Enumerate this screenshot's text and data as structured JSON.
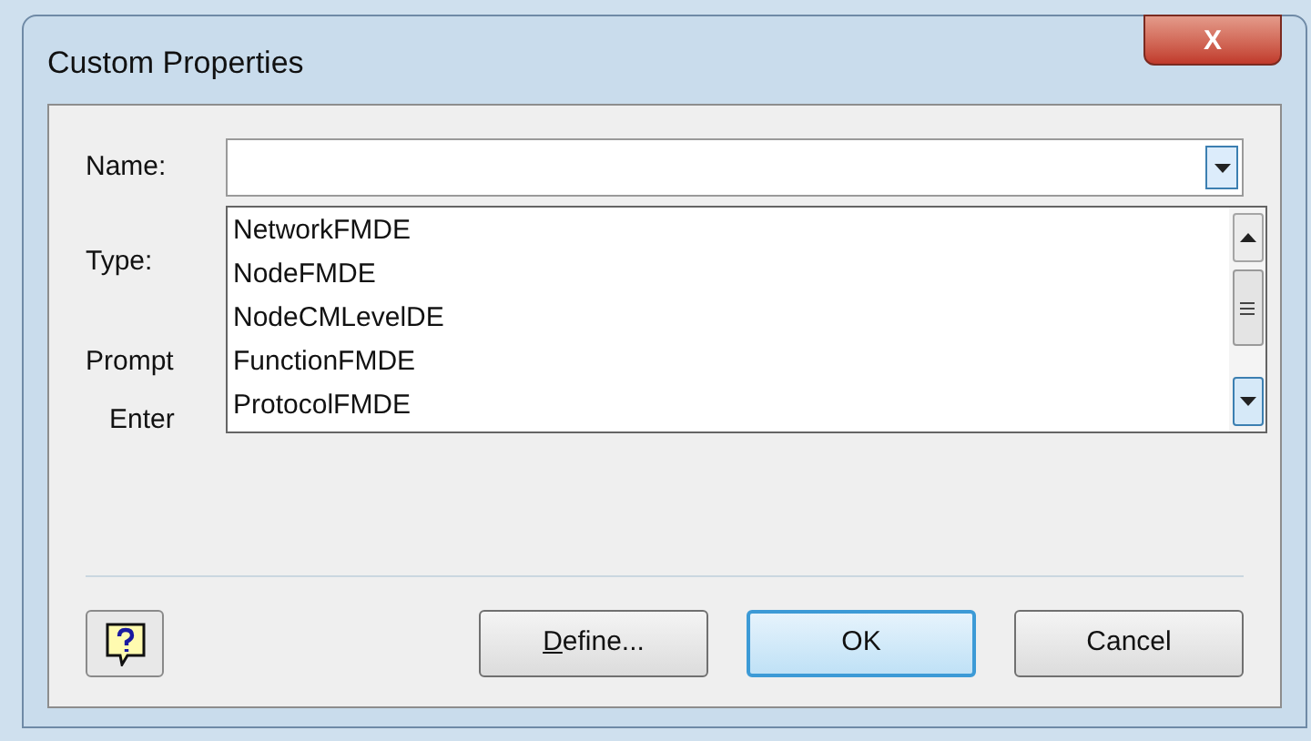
{
  "window": {
    "title": "Custom Properties",
    "close": "X"
  },
  "fields": [
    {
      "label": "Name:"
    },
    {
      "label": "Type:"
    },
    {
      "label": "Prompt"
    },
    {
      "label": "Enter"
    }
  ],
  "dropdown": {
    "items": [
      {
        "label": "NetworkFMDE",
        "selected": false
      },
      {
        "label": "NodeFMDE",
        "selected": false
      },
      {
        "label": "NodeCMLevelDE",
        "selected": false
      },
      {
        "label": "FunctionFMDE",
        "selected": false
      },
      {
        "label": "ProtocolFMDE",
        "selected": false
      }
    ]
  },
  "buttons": [
    {
      "label": "Define...",
      "default": false
    },
    {
      "label": "OK",
      "default": true
    },
    {
      "label": "Cancel",
      "default": false
    }
  ]
}
